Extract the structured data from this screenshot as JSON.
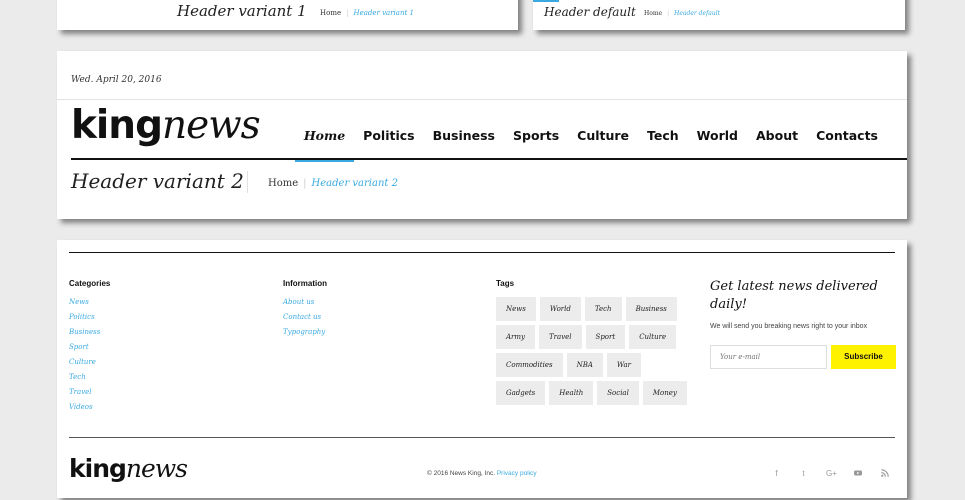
{
  "top_left": {
    "title": "Header variant 1",
    "crumb_home": "Home",
    "crumb_current": "Header variant 1"
  },
  "top_right": {
    "title": "Header default",
    "crumb_home": "Home",
    "crumb_current": "Header default"
  },
  "header": {
    "date": "Wed. April 20, 2016",
    "logo_bold": "king",
    "logo_italic": "news",
    "nav": [
      "Home",
      "Politics",
      "Business",
      "Sports",
      "Culture",
      "Tech",
      "World",
      "About",
      "Contacts"
    ],
    "page_title": "Header variant 2",
    "crumb_home": "Home",
    "crumb_current": "Header variant 2"
  },
  "footer": {
    "categories_title": "Categories",
    "categories": [
      "News",
      "Politics",
      "Business",
      "Sport",
      "Culture",
      "Tech",
      "Travel",
      "Videos"
    ],
    "information_title": "Information",
    "information": [
      "About us",
      "Contact us",
      "Typography"
    ],
    "tags_title": "Tags",
    "tag_rows": [
      [
        "News",
        "World",
        "Tech",
        "Business"
      ],
      [
        "Army",
        "Travel",
        "Sport",
        "Culture"
      ],
      [
        "Commodities",
        "NBA",
        "War"
      ],
      [
        "Gadgets",
        "Health",
        "Social",
        "Money"
      ]
    ],
    "newsletter_title": "Get latest news delivered daily!",
    "newsletter_text": "We will send you breaking news right to your inbox",
    "email_placeholder": "Your e-mail",
    "subscribe_label": "Subscribe",
    "logo_bold": "king",
    "logo_italic": "news",
    "copyright": "© 2016 News King, Inc.",
    "privacy": "Privacy policy",
    "social": [
      "f",
      "t",
      "G+",
      "yt",
      "rss"
    ]
  },
  "colors": {
    "accent": "#3aa9e0",
    "subscribe": "#fff200"
  }
}
